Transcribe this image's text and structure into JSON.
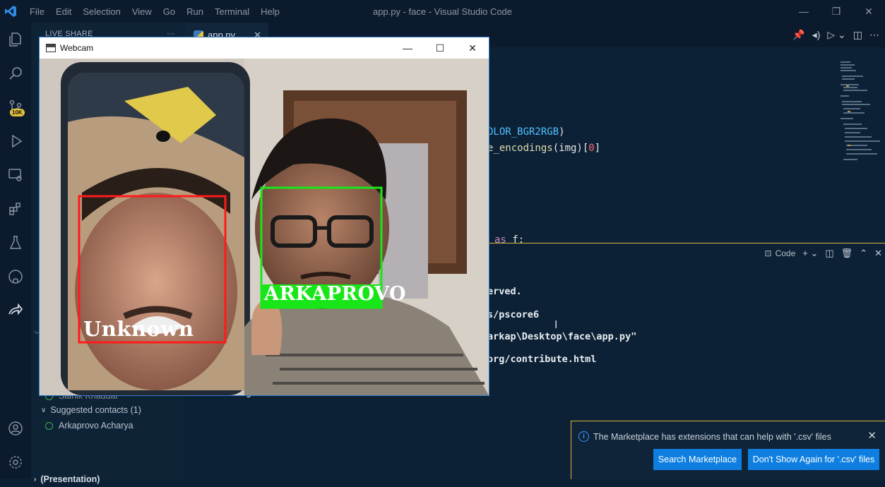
{
  "window": {
    "title": "app.py - face - Visual Studio Code",
    "menu": [
      "File",
      "Edit",
      "Selection",
      "View",
      "Go",
      "Run",
      "Terminal",
      "Help"
    ]
  },
  "activity_bar": {
    "badge": "10K"
  },
  "sidebar": {
    "section_title": "LIVE SHARE",
    "more": "···",
    "contacts": {
      "partial_contact": "Sainik Khaddar",
      "suggested_header": "Suggested contacts (1)",
      "suggested": [
        "Arkaprovo Acharya"
      ],
      "bottom_partial": "(Presentation)"
    }
  },
  "editor": {
    "tab_label": "app.py",
    "tab_close": "✕",
    "visible_code": {
      "line1_a": "OLOR_BGR2RGB",
      "line1_b": ")",
      "line2_a": "e_encodings",
      "line2_b": "(img)[",
      "line2_c": "0",
      "line2_d": "]",
      "line3_a": "as",
      "line3_b": " f:"
    }
  },
  "panel": {
    "terminal_dropdown": "Code",
    "terminal_lines": [
      "erved.",
      "s/pscore6",
      "arkap\\Desktop\\face\\app.py\"",
      "org/contribute.html"
    ],
    "partial_line": "g"
  },
  "notification": {
    "message": "The Marketplace has extensions that can help with '.csv' files",
    "close": "✕",
    "primary_button": "Search Marketplace",
    "secondary_button": "Don't Show Again for '.csv' files"
  },
  "webcam_window": {
    "title": "Webcam",
    "faces": [
      {
        "label": "Unknown",
        "box_color": "#ff1a1a"
      },
      {
        "label": "ARKAPROVO",
        "box_color": "#19e619"
      }
    ]
  },
  "colors": {
    "accent": "#0e7fe0",
    "focus_border": "#d9b736",
    "known_face": "#19e619",
    "unknown_face": "#ff1a1a"
  }
}
